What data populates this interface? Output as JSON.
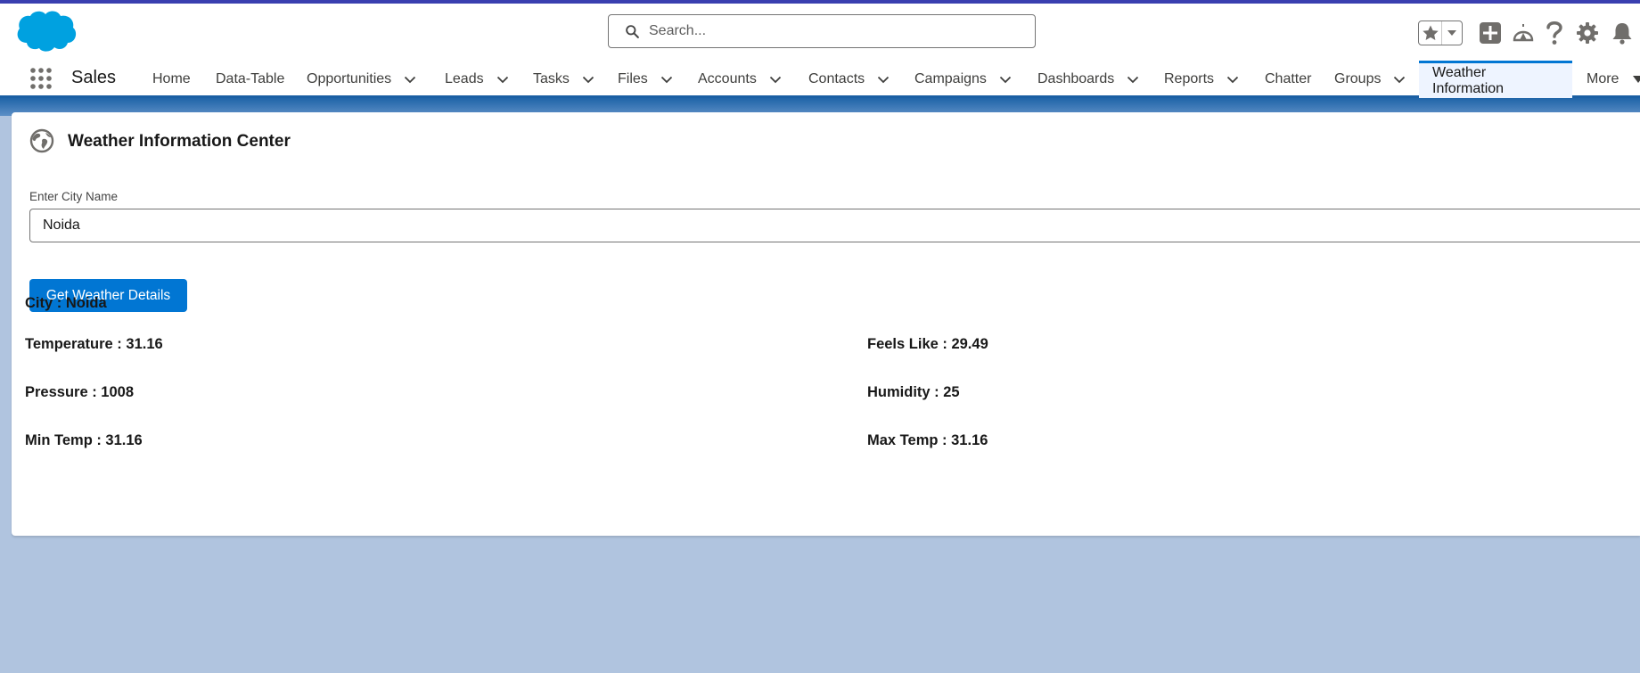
{
  "header": {
    "search_placeholder": "Search..."
  },
  "nav": {
    "app_name": "Sales",
    "items": [
      {
        "label": "Home"
      },
      {
        "label": "Data-Table"
      },
      {
        "label": "Opportunities"
      },
      {
        "label": "Leads"
      },
      {
        "label": "Tasks"
      },
      {
        "label": "Files"
      },
      {
        "label": "Accounts"
      },
      {
        "label": "Contacts"
      },
      {
        "label": "Campaigns"
      },
      {
        "label": "Dashboards"
      },
      {
        "label": "Reports"
      },
      {
        "label": "Chatter"
      },
      {
        "label": "Groups"
      },
      {
        "label": "Weather Information"
      },
      {
        "label": "More"
      }
    ]
  },
  "card": {
    "title": "Weather Information Center",
    "city_label": "Enter City Name",
    "city_value": "Noida",
    "button_label": "Get Weather Details",
    "city": "City : Noida",
    "temperature": "Temperature : 31.16",
    "feels_like": "Feels Like : 29.49",
    "pressure": "Pressure : 1008",
    "humidity": "Humidity : 25",
    "min_temp": "Min Temp : 31.16",
    "max_temp": "Max Temp : 31.16"
  },
  "colors": {
    "brand_blue": "#0176d3",
    "background": "#b0c4df",
    "top_stripe": "#3a3fb0"
  }
}
